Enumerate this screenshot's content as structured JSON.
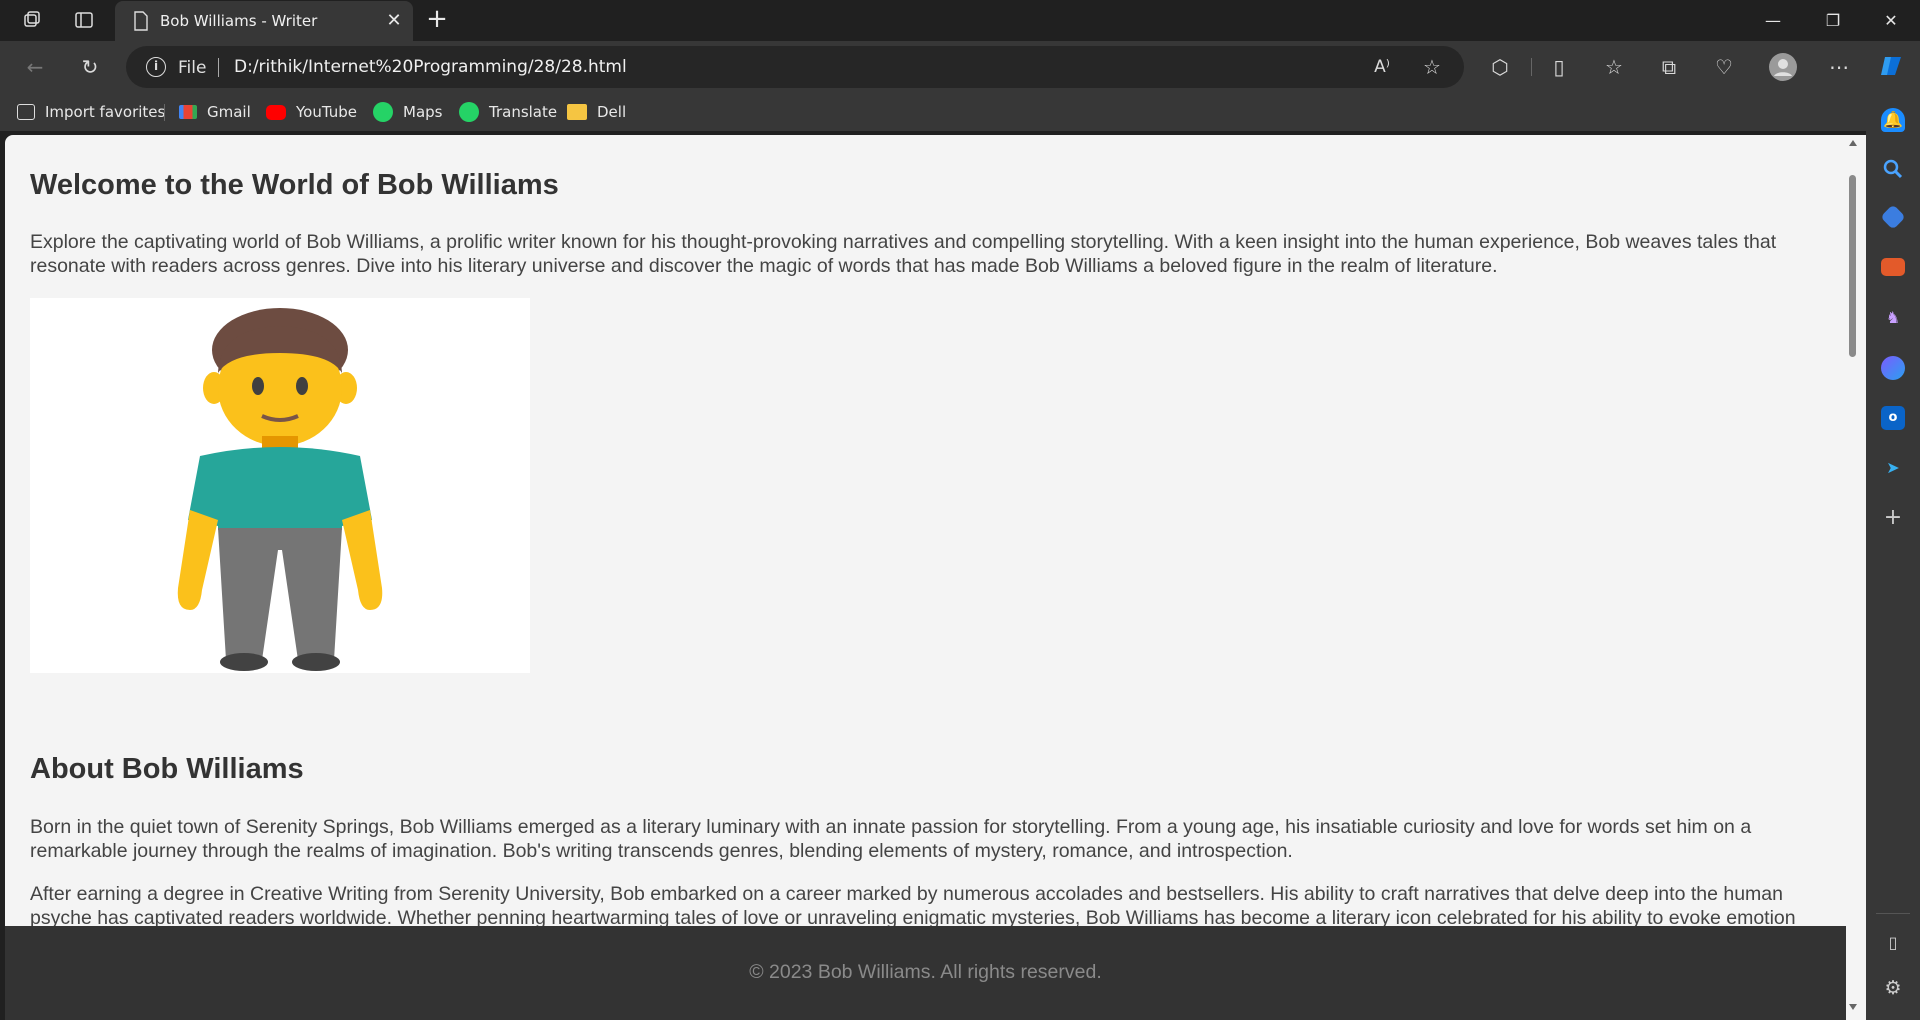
{
  "tab": {
    "title": "Bob Williams - Writer"
  },
  "address": {
    "scheme_label": "File",
    "url": "D:/rithik/Internet%20Programming/28/28.html"
  },
  "favorites": [
    {
      "label": "Import favorites",
      "icon": "import-icon"
    },
    {
      "label": "Gmail",
      "icon": "gmail-icon"
    },
    {
      "label": "YouTube",
      "icon": "youtube-icon"
    },
    {
      "label": "Maps",
      "icon": "maps-icon"
    },
    {
      "label": "Translate",
      "icon": "translate-icon"
    },
    {
      "label": "Dell",
      "icon": "folder-icon"
    }
  ],
  "page": {
    "heading": "Welcome to the World of Bob Williams",
    "intro": "Explore the captivating world of Bob Williams, a prolific writer known for his thought-provoking narratives and compelling storytelling. With a keen insight into the human experience, Bob weaves tales that resonate with readers across genres. Dive into his literary universe and discover the magic of words that has made Bob Williams a beloved figure in the realm of literature.",
    "about_heading": "About Bob Williams",
    "about_p1": "Born in the quiet town of Serenity Springs, Bob Williams emerged as a literary luminary with an innate passion for storytelling. From a young age, his insatiable curiosity and love for words set him on a remarkable journey through the realms of imagination. Bob's writing transcends genres, blending elements of mystery, romance, and introspection.",
    "about_p2": "After earning a degree in Creative Writing from Serenity University, Bob embarked on a career marked by numerous accolades and bestsellers. His ability to craft narratives that delve deep into the human psyche has captivated readers worldwide. Whether penning heartwarming tales of love or unraveling enigmatic mysteries, Bob Williams has become a literary icon celebrated for his ability to evoke emotion",
    "footer": "© 2023 Bob Williams. All rights reserved."
  },
  "colors": {
    "accent": "#0078d4",
    "footer_bg": "#333333",
    "page_bg": "#f4f4f4"
  }
}
